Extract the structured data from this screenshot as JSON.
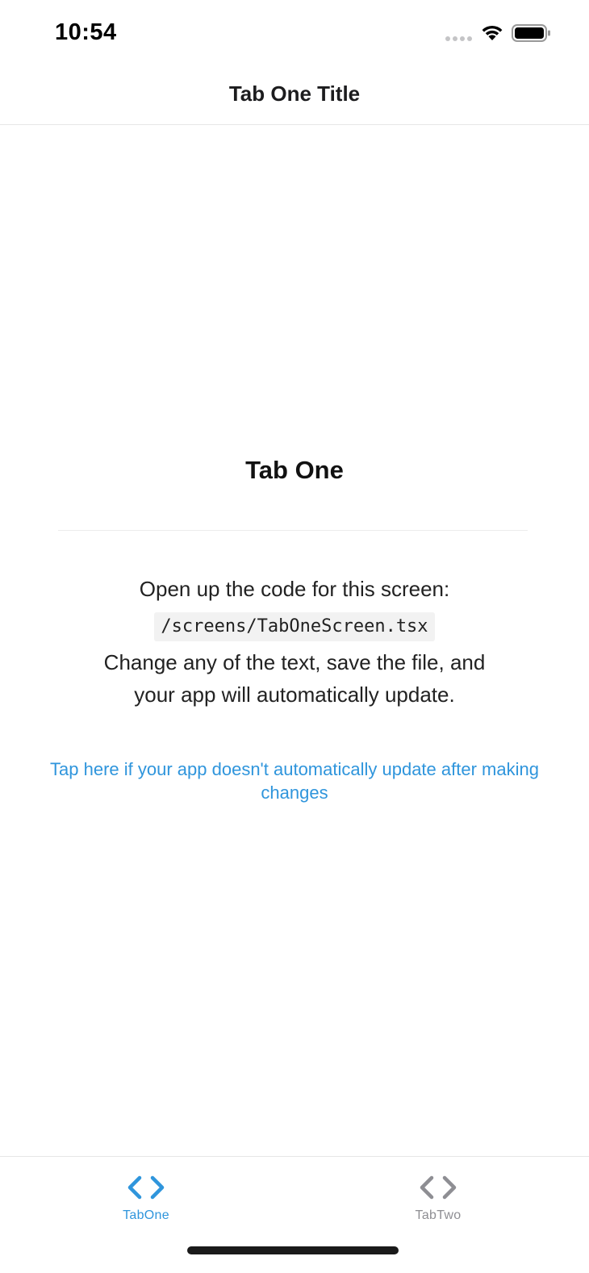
{
  "status_bar": {
    "time": "10:54"
  },
  "header": {
    "title": "Tab One Title"
  },
  "main": {
    "title": "Tab One",
    "intro_text": "Open up the code for this screen:",
    "code_path": "/screens/TabOneScreen.tsx",
    "change_line_1": "Change any of the text, save the file, and",
    "change_line_2": "your app will automatically update.",
    "help_link": "Tap here if your app doesn't automatically update after making changes"
  },
  "tab_bar": {
    "tabs": [
      {
        "label": "TabOne",
        "icon": "code-icon",
        "active": true
      },
      {
        "label": "TabTwo",
        "icon": "code-icon",
        "active": false
      }
    ]
  },
  "colors": {
    "accent": "#2f95dc",
    "inactive": "#8e8e93"
  }
}
